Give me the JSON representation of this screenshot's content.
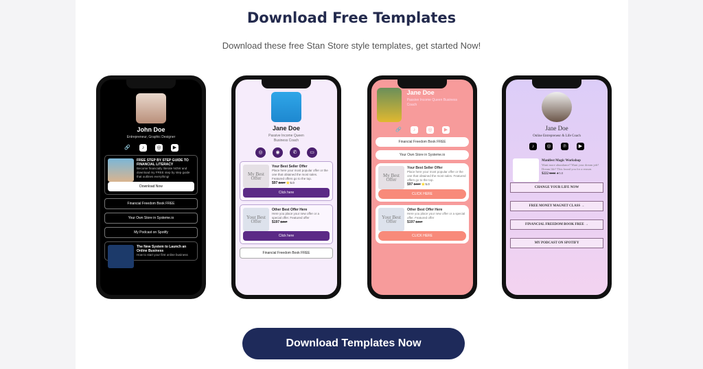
{
  "header": {
    "title": "Download Free Templates",
    "subtitle": "Download these free Stan Store style templates, get started Now!"
  },
  "phones": [
    {
      "name": "John Doe",
      "tagline": "Entrepreneur, Graphic Designer",
      "card_title": "FREE STEP BY STEP GUIDE TO FINANCIAL LITERACY",
      "card_text": "Become financially literate NOW and download my FREE step by step guide that outlines everything!",
      "card_button": "Download Now",
      "links": [
        "Financial Freedom Book FREE",
        "Your Own Store in Systeme.io",
        "My Podcast on Spotify"
      ],
      "card2_title": "The New System to Launch an Online Business",
      "card2_text": "How to start your first online business"
    },
    {
      "name": "Jane Doe",
      "tagline": "Passive Income Queen Business Coach",
      "offers": [
        {
          "thumb": "My Best Offer",
          "title": "Your Best Seller Offer",
          "text": "Place here your most popular offer or the one that obtained the most sales. Featured offers go to the top.",
          "price": "$97",
          "old": "$497",
          "rating": "5.0",
          "button": "Click here"
        },
        {
          "thumb": "Your Best Offer",
          "title": "Other Best Offer Here",
          "text": "Here you place your new offer or a special offer. Featured offer",
          "price": "$197",
          "old": "$497",
          "button": "Click here"
        }
      ],
      "link": "Financial Freedom Book FREE"
    },
    {
      "name": "Jane Doe",
      "tagline": "Passive Income Queen Business Coach",
      "links": [
        "Financial Freedom Book FREE",
        "Your Own Store in Systeme.io"
      ],
      "offers": [
        {
          "thumb": "My Best Offer",
          "title": "Your Best Seller Offer",
          "text": "Place here your most popular offer or the one that obtained the most sales. Featured offers go to the top.",
          "price": "$97",
          "old": "$497",
          "rating": "5.0",
          "button": "CLICK HERE"
        },
        {
          "thumb": "Your Best Offer",
          "title": "Other Best Offer Here",
          "text": "Here you place your new offer or a special offer. Featured offer",
          "price": "$197",
          "old": "$497",
          "button": "CLICK HERE"
        }
      ]
    },
    {
      "name": "Jane Doe",
      "tagline": "Online Entrepreneur & Life Coach",
      "card_title": "Manifest Magic Workshop",
      "card_text": "Want more abundance? Want your dream job? Dream life? This found you for a reason.",
      "price": "$222",
      "old": "$444",
      "rating": "5.0",
      "links": [
        "CHANGE YOUR LIFE NOW",
        "FREE MONEY MAGNET CLASS →",
        "FINANCIAL FREEDOM BOOK FREE →",
        "MY PODCAST ON SPOTIFY"
      ]
    }
  ],
  "cta": {
    "label": "Download Templates Now"
  },
  "colors": {
    "navy": "#1e2a5a",
    "purple": "#5b2a86",
    "coral": "#f79b9b",
    "lavender": "#e6d5f7"
  }
}
